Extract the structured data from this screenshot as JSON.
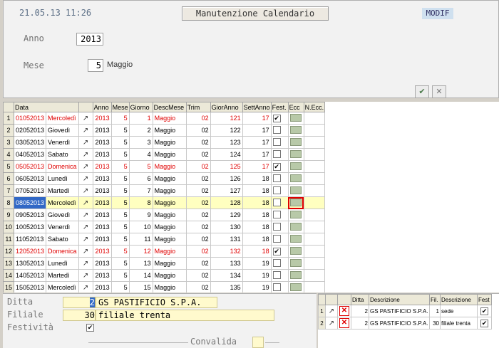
{
  "header": {
    "timestamp": "21.05.13 11:26",
    "title": "Manutenzione Calendario",
    "mode": "MODIF"
  },
  "form": {
    "anno_label": "Anno",
    "anno_value": "2013",
    "mese_label": "Mese",
    "mese_value": "5",
    "mese_name": "Maggio",
    "confirm_icon": "✔",
    "cancel_icon": "✕"
  },
  "grid": {
    "columns": [
      "Data",
      "",
      "Anno",
      "Mese",
      "Giorno",
      "DescMese",
      "Trim",
      "GiorAnno",
      "SettAnno",
      "Fest.",
      "Ecc",
      "N.Ecc."
    ],
    "rows": [
      {
        "n": "1",
        "data": "01052013",
        "dow": "Mercoledì",
        "anno": "2013",
        "mese": "5",
        "giorno": "1",
        "desc": "Maggio",
        "trim": "02",
        "gio": "121",
        "sett": "17",
        "fest": "✔",
        "holiday": true
      },
      {
        "n": "2",
        "data": "02052013",
        "dow": "Giovedì",
        "anno": "2013",
        "mese": "5",
        "giorno": "2",
        "desc": "Maggio",
        "trim": "02",
        "gio": "122",
        "sett": "17",
        "fest": "",
        "holiday": false
      },
      {
        "n": "3",
        "data": "03052013",
        "dow": "Venerdì",
        "anno": "2013",
        "mese": "5",
        "giorno": "3",
        "desc": "Maggio",
        "trim": "02",
        "gio": "123",
        "sett": "17",
        "fest": "",
        "holiday": false
      },
      {
        "n": "4",
        "data": "04052013",
        "dow": "Sabato",
        "anno": "2013",
        "mese": "5",
        "giorno": "4",
        "desc": "Maggio",
        "trim": "02",
        "gio": "124",
        "sett": "17",
        "fest": "",
        "holiday": false
      },
      {
        "n": "5",
        "data": "05052013",
        "dow": "Domenica",
        "anno": "2013",
        "mese": "5",
        "giorno": "5",
        "desc": "Maggio",
        "trim": "02",
        "gio": "125",
        "sett": "17",
        "fest": "✔",
        "holiday": true
      },
      {
        "n": "6",
        "data": "06052013",
        "dow": "Lunedì",
        "anno": "2013",
        "mese": "5",
        "giorno": "6",
        "desc": "Maggio",
        "trim": "02",
        "gio": "126",
        "sett": "18",
        "fest": "",
        "holiday": false
      },
      {
        "n": "7",
        "data": "07052013",
        "dow": "Martedì",
        "anno": "2013",
        "mese": "5",
        "giorno": "7",
        "desc": "Maggio",
        "trim": "02",
        "gio": "127",
        "sett": "18",
        "fest": "",
        "holiday": false
      },
      {
        "n": "8",
        "data": "08052013",
        "dow": "Mercoledì",
        "anno": "2013",
        "mese": "5",
        "giorno": "8",
        "desc": "Maggio",
        "trim": "02",
        "gio": "128",
        "sett": "18",
        "fest": "",
        "holiday": false
      },
      {
        "n": "9",
        "data": "09052013",
        "dow": "Giovedì",
        "anno": "2013",
        "mese": "5",
        "giorno": "9",
        "desc": "Maggio",
        "trim": "02",
        "gio": "129",
        "sett": "18",
        "fest": "",
        "holiday": false
      },
      {
        "n": "10",
        "data": "10052013",
        "dow": "Venerdì",
        "anno": "2013",
        "mese": "5",
        "giorno": "10",
        "desc": "Maggio",
        "trim": "02",
        "gio": "130",
        "sett": "18",
        "fest": "",
        "holiday": false
      },
      {
        "n": "11",
        "data": "11052013",
        "dow": "Sabato",
        "anno": "2013",
        "mese": "5",
        "giorno": "11",
        "desc": "Maggio",
        "trim": "02",
        "gio": "131",
        "sett": "18",
        "fest": "",
        "holiday": false
      },
      {
        "n": "12",
        "data": "12052013",
        "dow": "Domenica",
        "anno": "2013",
        "mese": "5",
        "giorno": "12",
        "desc": "Maggio",
        "trim": "02",
        "gio": "132",
        "sett": "18",
        "fest": "✔",
        "holiday": true
      },
      {
        "n": "13",
        "data": "13052013",
        "dow": "Lunedì",
        "anno": "2013",
        "mese": "5",
        "giorno": "13",
        "desc": "Maggio",
        "trim": "02",
        "gio": "133",
        "sett": "19",
        "fest": "",
        "holiday": false
      },
      {
        "n": "14",
        "data": "14052013",
        "dow": "Martedì",
        "anno": "2013",
        "mese": "5",
        "giorno": "14",
        "desc": "Maggio",
        "trim": "02",
        "gio": "134",
        "sett": "19",
        "fest": "",
        "holiday": false
      },
      {
        "n": "15",
        "data": "15052013",
        "dow": "Mercoledì",
        "anno": "2013",
        "mese": "5",
        "giorno": "15",
        "desc": "Maggio",
        "trim": "02",
        "gio": "135",
        "sett": "19",
        "fest": "",
        "holiday": false
      }
    ],
    "selected_row": "8"
  },
  "bottom": {
    "ditta_label": "Ditta",
    "ditta_code": "2",
    "ditta_name": "GS PASTIFICIO S.P.A.",
    "filiale_label": "Filiale",
    "filiale_code": "30",
    "filiale_name": "filiale trenta",
    "festivita_label": "Festività",
    "festivita_checked": "✔",
    "convalida_label": "Convalida"
  },
  "subgrid": {
    "columns": [
      "",
      "",
      "",
      "Ditta",
      "Descrizione",
      "Fil.",
      "Descrizione",
      "Fest"
    ],
    "rows": [
      {
        "n": "1",
        "ditta": "2",
        "desc": "GS PASTIFICIO S.P.A.",
        "fil": "1",
        "fdesc": "sede",
        "fest": "✔"
      },
      {
        "n": "2",
        "ditta": "2",
        "desc": "GS PASTIFICIO S.P.A.",
        "fil": "30",
        "fdesc": "filiale trenta",
        "fest": "✔"
      }
    ]
  }
}
